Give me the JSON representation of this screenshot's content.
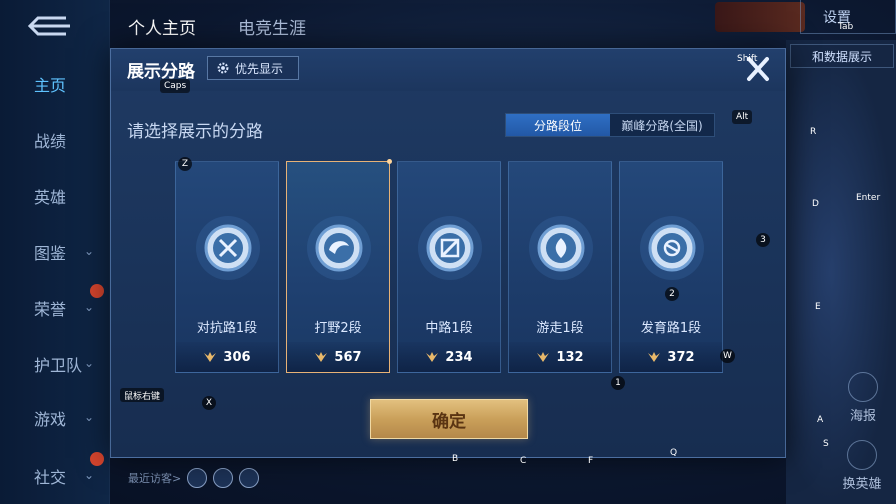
{
  "background": {
    "top_tabs": [
      "个人主页",
      "电竞生涯"
    ],
    "sidebar_items": [
      {
        "label": "主页",
        "active": true,
        "chevron": false
      },
      {
        "label": "战绩",
        "active": false,
        "chevron": false
      },
      {
        "label": "英雄",
        "active": false,
        "chevron": false
      },
      {
        "label": "图鉴",
        "active": false,
        "chevron": true
      },
      {
        "label": "荣誉",
        "active": false,
        "chevron": true
      },
      {
        "label": "护卫队",
        "active": false,
        "chevron": true
      },
      {
        "label": "游戏",
        "active": false,
        "chevron": true
      },
      {
        "label": "社交",
        "active": false,
        "chevron": true
      }
    ],
    "settings_label": "设置",
    "right_panel_label": "和数据展示",
    "poster_label": "海报",
    "swap_hero_label": "换英雄",
    "recent_visitors_label": "最近访客>"
  },
  "modal": {
    "title": "展示分路",
    "priority_button": "优先显示",
    "subtitle": "请选择展示的分路",
    "segments": [
      {
        "label": "分路段位",
        "active": true
      },
      {
        "label": "巅峰分路(全国)",
        "active": false
      }
    ],
    "cards": [
      {
        "role": "对抗路1段",
        "score": "306",
        "icon": "clash-lane-icon",
        "selected": false
      },
      {
        "role": "打野2段",
        "score": "567",
        "icon": "jungle-icon",
        "selected": true
      },
      {
        "role": "中路1段",
        "score": "234",
        "icon": "mid-lane-icon",
        "selected": false
      },
      {
        "role": "游走1段",
        "score": "132",
        "icon": "roam-icon",
        "selected": false
      },
      {
        "role": "发育路1段",
        "score": "372",
        "icon": "farm-lane-icon",
        "selected": false
      }
    ],
    "confirm_button": "确定"
  },
  "key_hints": {
    "tab": "Tab",
    "shift": "Shift",
    "caps": "Caps",
    "alt": "Alt",
    "r": "R",
    "enter": "Enter",
    "d": "D",
    "three": "3",
    "z": "Z",
    "two": "2",
    "e": "E",
    "w": "W",
    "one": "1",
    "mouse_right": "鼠标右键",
    "x": "X",
    "a": "A",
    "s": "S",
    "q": "Q",
    "b": "B",
    "c": "C",
    "f": "F"
  },
  "colors": {
    "accent_blue": "#2f6fc4",
    "selected_border": "#e7b276",
    "confirm_gold": "#caa05a"
  }
}
